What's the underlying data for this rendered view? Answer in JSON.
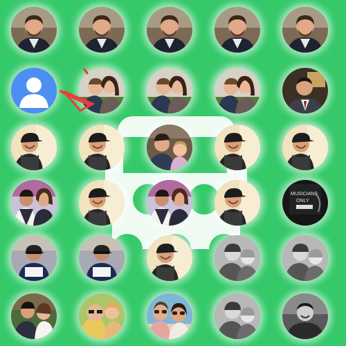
{
  "colors": {
    "background": "#35c96a",
    "avatar_blue": "#4d8ef2",
    "arrow_red": "#f23b3b"
  },
  "watermark": {
    "icon": "photo-pile-logo-icon"
  },
  "default_avatar": {
    "icon": "default-user-avatar-icon"
  },
  "arrow": {
    "icon": "red-pointer-arrow-icon"
  },
  "grid": {
    "rows": 6,
    "cols": 5,
    "photos": [
      [
        "portrait-man-beard",
        "portrait-man-beard",
        "portrait-man-beard",
        "portrait-man-beard",
        "portrait-man-beard"
      ],
      [
        "default-avatar",
        "couple-kiss",
        "couple-kiss",
        "couple-kiss",
        "man-suit"
      ],
      [
        "man-cap",
        "man-cap",
        "man-with-child",
        "man-cap",
        "man-cap"
      ],
      [
        "couple-party",
        "man-cap",
        "couple-party",
        "man-cap",
        "musicians-only-poster"
      ],
      [
        "runner-race",
        "runner-race",
        "man-cap",
        "friends-bw",
        "friends-bw"
      ],
      [
        "wedding-couple",
        "friends-selfie",
        "women-sunglasses",
        "friends-bw",
        "man-bw-smiling"
      ]
    ],
    "poster_text": "MUSICIANS ONLY"
  }
}
